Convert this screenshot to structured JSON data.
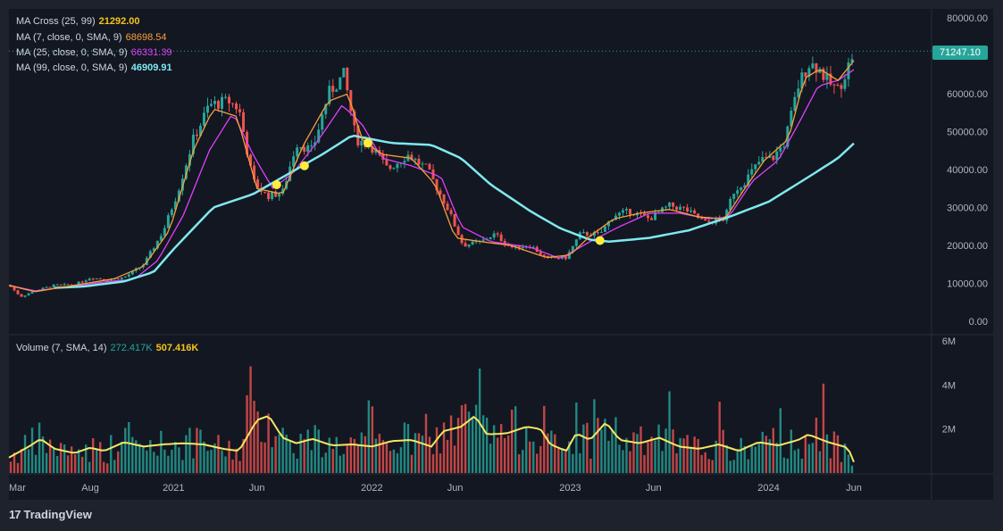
{
  "legend": {
    "ma_cross": {
      "label": "MA Cross (25, 99)",
      "value": "21292.00",
      "color": "#f5c518"
    },
    "ma7": {
      "label": "MA (7, close, 0, SMA, 9)",
      "value": "68698.54",
      "color": "#f7a03a"
    },
    "ma25": {
      "label": "MA (25, close, 0, SMA, 9)",
      "value": "66331.39",
      "color": "#e040fb"
    },
    "ma99": {
      "label": "MA (99, close, 0, SMA, 9)",
      "value": "46909.91",
      "color": "#7fe9ef"
    },
    "volume": {
      "label": "Volume (7, SMA, 14)",
      "value1": "272.417K",
      "value2": "507.416K",
      "color1": "#26a69a",
      "color2": "#f5c518"
    }
  },
  "price_tag": "71247.10",
  "brand": {
    "logo": "17",
    "name": "TradingView"
  },
  "chart_data": {
    "type": "candlestick",
    "price_axis": {
      "ticks": [
        "80000.00",
        "70000.00",
        "60000.00",
        "50000.00",
        "40000.00",
        "30000.00",
        "20000.00",
        "10000.00",
        "0.00"
      ],
      "ylim": [
        0,
        80000
      ]
    },
    "volume_axis": {
      "ticks": [
        "6M",
        "4M",
        "2M"
      ],
      "ylim": [
        0,
        6000000
      ]
    },
    "x_ticks": [
      "Mar",
      "Aug",
      "2021",
      "Jun",
      "2022",
      "Jun",
      "2023",
      "Jun",
      "2024",
      "Jun"
    ],
    "last_price": 71247.1,
    "price_path": [
      [
        2020.17,
        9500
      ],
      [
        2020.23,
        6500
      ],
      [
        2020.3,
        8000
      ],
      [
        2020.4,
        9500
      ],
      [
        2020.5,
        9600
      ],
      [
        2020.58,
        11500
      ],
      [
        2020.67,
        11000
      ],
      [
        2020.75,
        11500
      ],
      [
        2020.85,
        15000
      ],
      [
        2020.95,
        24000
      ],
      [
        2021.02,
        34000
      ],
      [
        2021.1,
        48000
      ],
      [
        2021.18,
        57000
      ],
      [
        2021.28,
        58000
      ],
      [
        2021.33,
        56000
      ],
      [
        2021.4,
        37000
      ],
      [
        2021.47,
        33000
      ],
      [
        2021.55,
        34000
      ],
      [
        2021.62,
        47000
      ],
      [
        2021.7,
        45000
      ],
      [
        2021.78,
        60000
      ],
      [
        2021.86,
        65000
      ],
      [
        2021.92,
        48000
      ],
      [
        2022.0,
        46000
      ],
      [
        2022.08,
        40000
      ],
      [
        2022.18,
        44000
      ],
      [
        2022.28,
        40000
      ],
      [
        2022.38,
        30000
      ],
      [
        2022.46,
        20000
      ],
      [
        2022.55,
        21000
      ],
      [
        2022.62,
        23000
      ],
      [
        2022.7,
        19500
      ],
      [
        2022.8,
        20000
      ],
      [
        2022.88,
        16500
      ],
      [
        2022.98,
        16800
      ],
      [
        2023.05,
        23000
      ],
      [
        2023.15,
        23000
      ],
      [
        2023.22,
        28000
      ],
      [
        2023.3,
        29000
      ],
      [
        2023.4,
        27000
      ],
      [
        2023.5,
        30500
      ],
      [
        2023.58,
        29500
      ],
      [
        2023.68,
        26000
      ],
      [
        2023.78,
        27000
      ],
      [
        2023.82,
        34000
      ],
      [
        2023.88,
        37000
      ],
      [
        2023.96,
        42500
      ],
      [
        2024.02,
        43000
      ],
      [
        2024.08,
        47000
      ],
      [
        2024.15,
        62000
      ],
      [
        2024.2,
        68000
      ],
      [
        2024.25,
        67000
      ],
      [
        2024.3,
        63000
      ],
      [
        2024.35,
        61000
      ],
      [
        2024.4,
        67000
      ],
      [
        2024.43,
        71247
      ]
    ],
    "ma_lines": [
      {
        "name": "MA (25, close, 0, SMA, 9)",
        "color": "#e040fb",
        "points": [
          [
            2020.17,
            9500
          ],
          [
            2020.3,
            8000
          ],
          [
            2020.5,
            9300
          ],
          [
            2020.67,
            10500
          ],
          [
            2020.8,
            11000
          ],
          [
            2020.92,
            16000
          ],
          [
            2021.05,
            28000
          ],
          [
            2021.18,
            45000
          ],
          [
            2021.3,
            55000
          ],
          [
            2021.4,
            44000
          ],
          [
            2021.5,
            35000
          ],
          [
            2021.6,
            39000
          ],
          [
            2021.72,
            47000
          ],
          [
            2021.85,
            57000
          ],
          [
            2021.95,
            52000
          ],
          [
            2022.05,
            43000
          ],
          [
            2022.2,
            41000
          ],
          [
            2022.35,
            38000
          ],
          [
            2022.45,
            25000
          ],
          [
            2022.6,
            21000
          ],
          [
            2022.8,
            19500
          ],
          [
            2022.95,
            16500
          ],
          [
            2023.1,
            21000
          ],
          [
            2023.25,
            25000
          ],
          [
            2023.4,
            28500
          ],
          [
            2023.55,
            28500
          ],
          [
            2023.7,
            27000
          ],
          [
            2023.8,
            27500
          ],
          [
            2023.92,
            37000
          ],
          [
            2024.05,
            42500
          ],
          [
            2024.15,
            52000
          ],
          [
            2024.25,
            62000
          ],
          [
            2024.35,
            63500
          ],
          [
            2024.43,
            66331
          ]
        ]
      },
      {
        "name": "MA (99, close, 0, SMA, 9)",
        "color": "#7fe9ef",
        "points": [
          [
            2020.4,
            8800
          ],
          [
            2020.55,
            9200
          ],
          [
            2020.75,
            10500
          ],
          [
            2020.9,
            13000
          ],
          [
            2021.0,
            19000
          ],
          [
            2021.2,
            30000
          ],
          [
            2021.4,
            33500
          ],
          [
            2021.55,
            38000
          ],
          [
            2021.75,
            44000
          ],
          [
            2021.9,
            49000
          ],
          [
            2022.1,
            47000
          ],
          [
            2022.3,
            46500
          ],
          [
            2022.45,
            43000
          ],
          [
            2022.6,
            36000
          ],
          [
            2022.8,
            29000
          ],
          [
            2022.95,
            24500
          ],
          [
            2023.1,
            21500
          ],
          [
            2023.2,
            21000
          ],
          [
            2023.4,
            22000
          ],
          [
            2023.6,
            24000
          ],
          [
            2023.8,
            27500
          ],
          [
            2024.0,
            31500
          ],
          [
            2024.2,
            38000
          ],
          [
            2024.35,
            43000
          ],
          [
            2024.43,
            46910
          ]
        ]
      },
      {
        "name": "MA (7, close, 0, SMA, 9)",
        "color": "#f7a03a",
        "points": [
          [
            2020.17,
            9500
          ],
          [
            2020.3,
            7800
          ],
          [
            2020.5,
            9500
          ],
          [
            2020.7,
            11200
          ],
          [
            2020.85,
            14500
          ],
          [
            2020.98,
            24000
          ],
          [
            2021.1,
            45000
          ],
          [
            2021.2,
            56000
          ],
          [
            2021.32,
            54000
          ],
          [
            2021.42,
            35000
          ],
          [
            2021.55,
            33500
          ],
          [
            2021.65,
            46000
          ],
          [
            2021.78,
            58000
          ],
          [
            2021.88,
            60000
          ],
          [
            2021.95,
            48000
          ],
          [
            2022.05,
            44000
          ],
          [
            2022.2,
            43000
          ],
          [
            2022.32,
            36000
          ],
          [
            2022.42,
            22000
          ],
          [
            2022.55,
            21000
          ],
          [
            2022.7,
            20000
          ],
          [
            2022.88,
            16800
          ],
          [
            2023.0,
            17500
          ],
          [
            2023.1,
            22500
          ],
          [
            2023.22,
            27000
          ],
          [
            2023.35,
            28500
          ],
          [
            2023.5,
            29500
          ],
          [
            2023.65,
            27500
          ],
          [
            2023.78,
            27000
          ],
          [
            2023.88,
            35000
          ],
          [
            2023.98,
            42500
          ],
          [
            2024.1,
            48000
          ],
          [
            2024.18,
            64000
          ],
          [
            2024.26,
            66500
          ],
          [
            2024.35,
            63500
          ],
          [
            2024.43,
            68699
          ]
        ]
      }
    ],
    "cross_markers": [
      [
        2021.52,
        36000
      ],
      [
        2021.66,
        41000
      ],
      [
        2021.98,
        47000
      ],
      [
        2023.15,
        21300
      ]
    ],
    "volume_sma": [
      [
        2020.17,
        700
      ],
      [
        2020.27,
        1200
      ],
      [
        2020.33,
        1550
      ],
      [
        2020.4,
        1100
      ],
      [
        2020.5,
        900
      ],
      [
        2020.58,
        1150
      ],
      [
        2020.65,
        1000
      ],
      [
        2020.75,
        1400
      ],
      [
        2020.85,
        1200
      ],
      [
        2020.95,
        1300
      ],
      [
        2021.05,
        1350
      ],
      [
        2021.15,
        1300
      ],
      [
        2021.25,
        1100
      ],
      [
        2021.33,
        1000
      ],
      [
        2021.42,
        2400
      ],
      [
        2021.48,
        2600
      ],
      [
        2021.55,
        1600
      ],
      [
        2021.62,
        1350
      ],
      [
        2021.7,
        1550
      ],
      [
        2021.8,
        1250
      ],
      [
        2021.9,
        1300
      ],
      [
        2022.0,
        1200
      ],
      [
        2022.1,
        1450
      ],
      [
        2022.2,
        1500
      ],
      [
        2022.3,
        1200
      ],
      [
        2022.36,
        1900
      ],
      [
        2022.45,
        2100
      ],
      [
        2022.52,
        2600
      ],
      [
        2022.58,
        1750
      ],
      [
        2022.68,
        1800
      ],
      [
        2022.78,
        2100
      ],
      [
        2022.85,
        2000
      ],
      [
        2022.9,
        1300
      ],
      [
        2022.98,
        1000
      ],
      [
        2023.03,
        1800
      ],
      [
        2023.1,
        1500
      ],
      [
        2023.18,
        2300
      ],
      [
        2023.25,
        1500
      ],
      [
        2023.35,
        1350
      ],
      [
        2023.45,
        1600
      ],
      [
        2023.55,
        1200
      ],
      [
        2023.65,
        1100
      ],
      [
        2023.75,
        1300
      ],
      [
        2023.85,
        1000
      ],
      [
        2023.95,
        1400
      ],
      [
        2024.05,
        1250
      ],
      [
        2024.15,
        1500
      ],
      [
        2024.2,
        1750
      ],
      [
        2024.3,
        1400
      ],
      [
        2024.4,
        1150
      ],
      [
        2024.43,
        500
      ]
    ]
  }
}
